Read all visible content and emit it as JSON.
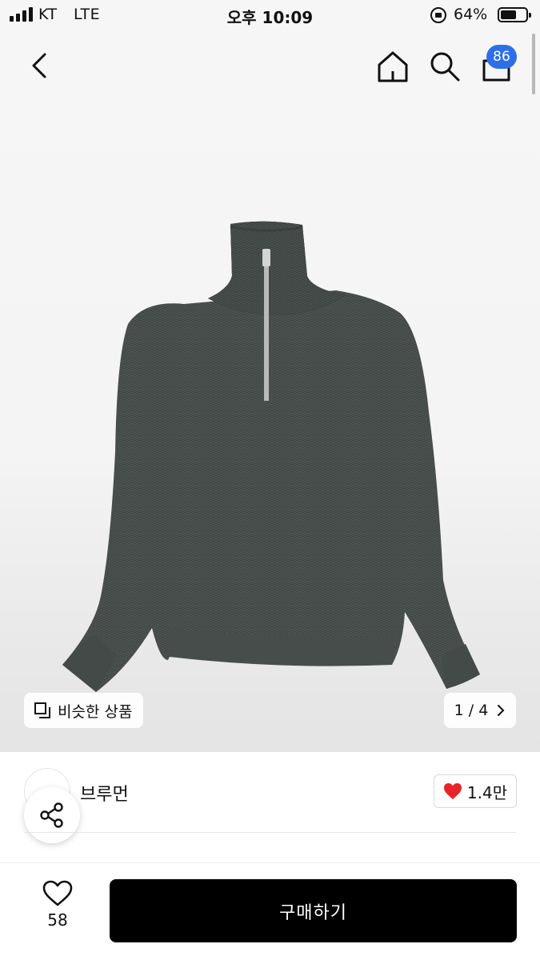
{
  "status_bar": {
    "carrier": "KT",
    "network": "LTE",
    "time": "오후 10:09",
    "battery_percent": "64%",
    "battery_level": 0.64
  },
  "nav": {
    "back_icon": "chevron-left-icon",
    "home_icon": "home-icon",
    "search_icon": "search-icon",
    "cart_icon": "cart-icon",
    "cart_badge": "86",
    "badge_color": "#2c6fe8"
  },
  "product": {
    "image_icon": "sweater-image",
    "color": "#4c5250",
    "similar_button_label": "비슷한 상품",
    "pager": "1 / 4",
    "pager_current": 1,
    "pager_total": 4
  },
  "info": {
    "brand_name": "브루먼",
    "like_count": "1.4만",
    "heart_color": "#e8232a"
  },
  "bottom_bar": {
    "wish_count": "58",
    "buy_label": "구매하기"
  }
}
